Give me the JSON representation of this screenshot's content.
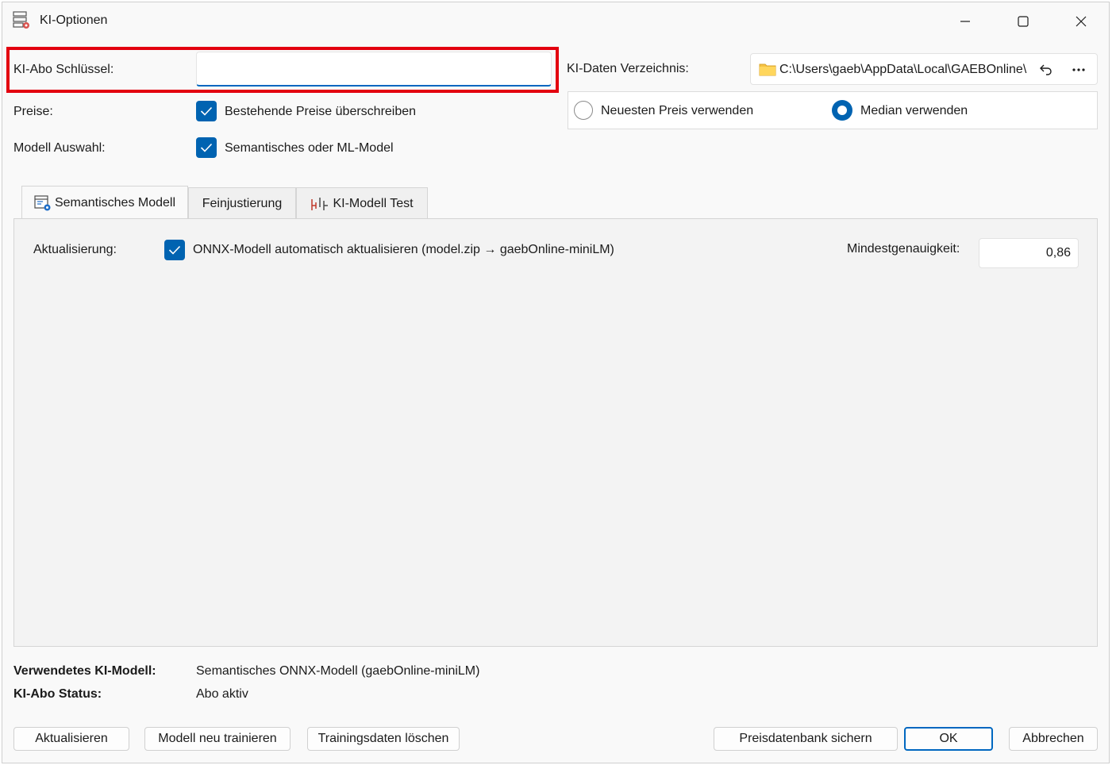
{
  "window": {
    "title": "KI-Optionen",
    "icon": "settings-server-icon",
    "caption_buttons": [
      "minimize-icon",
      "maximize-icon",
      "close-icon"
    ]
  },
  "form": {
    "abo_key": {
      "label": "KI-Abo Schlüssel:",
      "value": ""
    },
    "data_dir": {
      "label": "KI-Daten Verzeichnis:",
      "value": "C:\\Users\\gaeb\\AppData\\Local\\GAEBOnline\\I",
      "icon": "folder-icon"
    },
    "prices": {
      "label": "Preise:",
      "checkbox_label": "Bestehende Preise überschreiben",
      "checked": true
    },
    "model_selection": {
      "label": "Modell Auswahl:",
      "checkbox_label": "Semantisches oder ML-Model",
      "checked": true
    },
    "price_mode": {
      "options": [
        {
          "label": "Neuesten Preis verwenden",
          "selected": false
        },
        {
          "label": "Median verwenden",
          "selected": true
        }
      ]
    }
  },
  "tabs": [
    {
      "label": "Semantisches Modell",
      "active": true
    },
    {
      "label": "Feinjustierung",
      "active": false
    },
    {
      "label": "KI-Modell Test",
      "active": false
    }
  ],
  "semantic_tab": {
    "update_label": "Aktualisierung:",
    "auto_update_label": "ONNX-Modell automatisch aktualisieren (model.zip → gaebOnline-miniLM)",
    "auto_update_checked": true,
    "min_accuracy_label": "Mindestgenauigkeit:",
    "min_accuracy_value": "0,86"
  },
  "status": {
    "model_label": "Verwendetes KI-Modell:",
    "model_value": "Semantisches ONNX-Modell (gaebOnline-miniLM)",
    "abo_label": "KI-Abo Status:",
    "abo_value": "Abo aktiv"
  },
  "buttons": {
    "refresh": "Aktualisieren",
    "retrain": "Modell neu trainieren",
    "delete_training": "Trainingsdaten löschen",
    "backup_db": "Preisdatenbank sichern",
    "ok": "OK",
    "cancel": "Abbrechen"
  },
  "colors": {
    "accent": "#0063b1",
    "highlight": "#e3000f",
    "background": "#f9f9f9"
  }
}
